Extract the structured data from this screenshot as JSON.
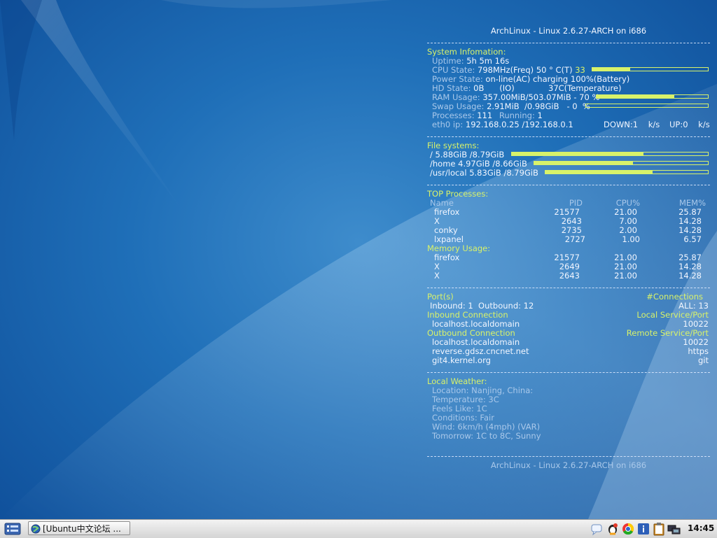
{
  "header": "ArchLinux - Linux 2.6.27-ARCH on i686",
  "footer": "ArchLinux - Linux 2.6.27-ARCH on i686",
  "system": {
    "title": "System Infomation:",
    "uptime_label": "Uptime:",
    "uptime_value": "5h 5m 16s",
    "cpu_label": "CPU State:",
    "cpu_value": "798MHz(Freq) 50  ° C(T)",
    "cpu_percent": "33",
    "cpu_bar": 0.33,
    "power_label": "Power State:",
    "power_value": "on-line(AC) charging 100%(Battery)",
    "hd_label": "HD State:",
    "hd_value": "0B      (IO)",
    "hd_temp": "37C(Temperature)",
    "ram_label": "RAM Usage:",
    "ram_value": "357.00MiB/503.07MiB - 70 %",
    "ram_bar": 0.7,
    "swap_label": "Swap Usage:",
    "swap_value": "2.91MiB  /0.98GiB   - 0  %",
    "swap_bar": 0.0,
    "proc_label": "Processes:",
    "proc_value": "111",
    "running_label": "Running:",
    "running_value": "1",
    "eth_label": "eth0 ip:",
    "eth_value": "192.168.0.25 /192.168.0.1",
    "down": "DOWN:1    k/s",
    "up": "UP:0    k/s"
  },
  "filesystems": {
    "title": "File systems:",
    "items": [
      {
        "label": "/ 5.88GiB  /8.79GiB",
        "fill": 0.67
      },
      {
        "label": "/home 4.97GiB  /8.66GiB",
        "fill": 0.57
      },
      {
        "label": "/usr/local 5.83GiB  /8.79GiB",
        "fill": 0.66
      }
    ]
  },
  "top": {
    "title": "TOP Processes:",
    "headers": {
      "name": "Name",
      "pid": "PID",
      "cpu": "CPU%",
      "mem": "MEM%"
    },
    "rows": [
      {
        "name": "firefox",
        "pid": "21577",
        "cpu": "21.00",
        "mem": "25.87"
      },
      {
        "name": "X",
        "pid": "2643",
        "cpu": "7.00",
        "mem": "14.28"
      },
      {
        "name": "conky",
        "pid": "2735",
        "cpu": "2.00",
        "mem": "14.28"
      },
      {
        "name": "lxpanel",
        "pid": "2727",
        "cpu": "1.00",
        "mem": "6.57"
      }
    ],
    "mem_title": "Memory Usage:",
    "mem_rows": [
      {
        "name": "firefox",
        "pid": "21577",
        "cpu": "21.00",
        "mem": "25.87"
      },
      {
        "name": "X",
        "pid": "2649",
        "cpu": "21.00",
        "mem": "14.28"
      },
      {
        "name": "X",
        "pid": "2643",
        "cpu": "21.00",
        "mem": "14.28"
      }
    ]
  },
  "ports": {
    "title": "Port(s)",
    "connections": "#Connections",
    "inbound_summary": "Inbound: 1  Outbound: 12",
    "all": "ALL: 13",
    "inbound_title": "Inbound Connection",
    "local_service": "Local Service/Port",
    "inbound_rows": [
      {
        "host": "localhost.localdomain",
        "port": "10022"
      }
    ],
    "outbound_title": "Outbound Connection",
    "remote_service": "Remote Service/Port",
    "outbound_rows": [
      {
        "host": "localhost.localdomain",
        "port": "10022"
      },
      {
        "host": "reverse.gdsz.cncnet.net",
        "port": "https"
      },
      {
        "host": "git4.kernel.org",
        "port": "git"
      }
    ]
  },
  "weather": {
    "title": "Local Weather:",
    "lines": [
      "Location: Nanjing, China:",
      "Temperature: 3C",
      "Feels Like: 1C",
      "Conditions: Fair",
      "Wind: 6km/h (4mph) (VAR)",
      "Tomorrow: 1C to 8C, Sunny"
    ]
  },
  "taskbar": {
    "task_label": "[Ubuntu中文论坛 ...",
    "clock": "14:45"
  },
  "colors": {
    "accent": "#d8f26a",
    "text": "#f2f6ff",
    "dim": "#a9c8ea"
  }
}
